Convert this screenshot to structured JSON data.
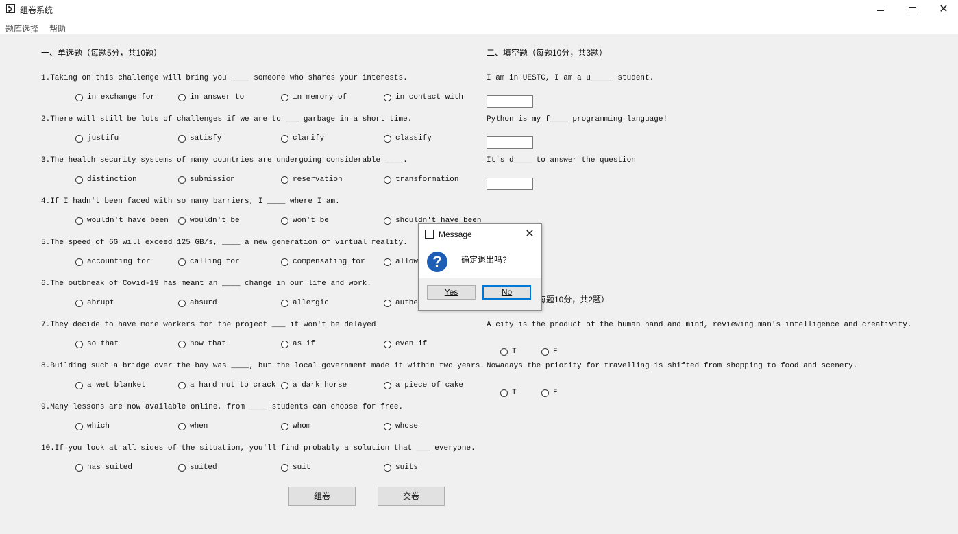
{
  "window": {
    "title": "组卷系统"
  },
  "menu": [
    "题库选择",
    "帮助"
  ],
  "single_choice": {
    "heading": "一、单选题（每题5分，共10题）",
    "questions": [
      {
        "text": "1.Taking on this challenge will bring you ____ someone who shares your interests.",
        "options": [
          "in exchange for",
          "in answer to",
          "in memory of",
          "in contact with"
        ]
      },
      {
        "text": "2.There will still be lots of challenges if we are to ___ garbage in a short time.",
        "options": [
          "justifu",
          "satisfy",
          "clarify",
          "classify"
        ]
      },
      {
        "text": "3.The health security systems of many countries are undergoing considerable ____.",
        "options": [
          "distinction",
          "submission",
          "reservation",
          "transformation"
        ]
      },
      {
        "text": "4.If I hadn't been faced with so many barriers, I ____ where I am.",
        "options": [
          "wouldn't have been",
          "wouldn't be",
          "won't be",
          "shouldn't have been"
        ]
      },
      {
        "text": "5.The speed of 6G will exceed 125 GB/s, ____ a new generation of virtual reality.",
        "options": [
          "accounting for",
          "calling for",
          "compensating for",
          "allow"
        ]
      },
      {
        "text": "6.The outbreak of Covid-19 has meant an ____ change in our life and work.",
        "options": [
          "abrupt",
          "absurd",
          "allergic",
          "auther"
        ]
      },
      {
        "text": "7.They decide to have more workers for the project ___ it won't be delayed",
        "options": [
          "so that",
          "now that",
          "as if",
          "even if"
        ]
      },
      {
        "text": "8.Building such a bridge over the bay was ____, but the local government made it within two years.",
        "options": [
          "a wet blanket",
          "a hard nut to crack",
          "a dark horse",
          "a piece of cake"
        ]
      },
      {
        "text": "9.Many lessons are now available online, from ____ students can choose for free.",
        "options": [
          "which",
          "when",
          "whom",
          "whose"
        ]
      },
      {
        "text": "10.If you look at all sides of the situation, you'll find probably a solution that ___ everyone.",
        "options": [
          "has suited",
          "suited",
          "suit",
          "suits"
        ]
      }
    ]
  },
  "fill_blank": {
    "heading": "二、填空题（每题10分，共3题）",
    "questions": [
      {
        "text": "I am in UESTC, I am a u_____ student.",
        "value": ""
      },
      {
        "text": "Python is my f____ programming language!",
        "value": ""
      },
      {
        "text": "It's d____ to answer the question",
        "value": ""
      }
    ]
  },
  "true_false": {
    "heading_visible": "每题10分，共2题）",
    "questions": [
      {
        "text": "A city is the product of the human hand and mind, reviewing man's intelligence and creativity.",
        "options": [
          "T",
          "F"
        ]
      },
      {
        "text": "Nowadays the priority for travelling is shifted from shopping to food and scenery.",
        "options": [
          "T",
          "F"
        ]
      }
    ]
  },
  "buttons": {
    "compose": "组卷",
    "submit": "交卷"
  },
  "dialog": {
    "title": "Message",
    "message": "确定退出吗?",
    "yes": "Yes",
    "no": "No",
    "icon": "question-icon"
  }
}
